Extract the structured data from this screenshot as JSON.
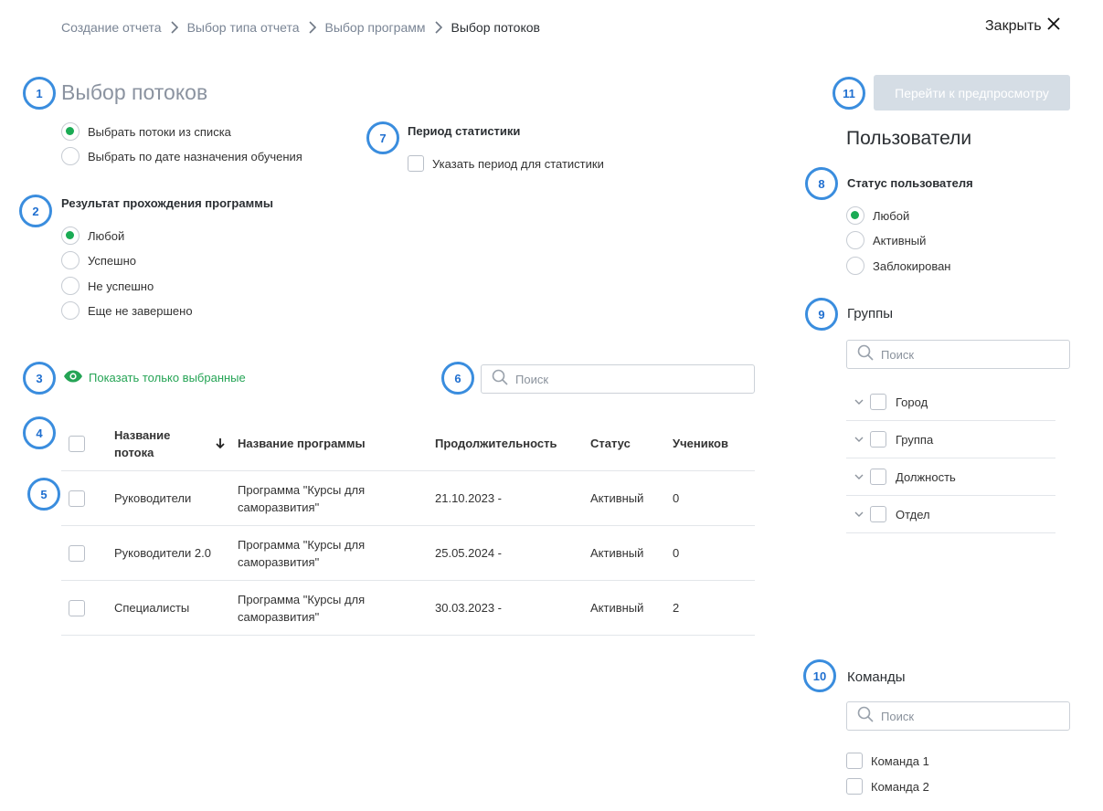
{
  "breadcrumb": {
    "items": [
      "Создание отчета",
      "Выбор типа отчета",
      "Выбор программ"
    ],
    "current": "Выбор потоков"
  },
  "close_label": "Закрыть",
  "markers": [
    "1",
    "2",
    "3",
    "4",
    "5",
    "6",
    "7",
    "8",
    "9",
    "10",
    "11"
  ],
  "title": "Выбор потоков",
  "stream_selection": {
    "options": [
      {
        "label": "Выбрать потоки из списка",
        "selected": true
      },
      {
        "label": "Выбрать по дате назначения обучения",
        "selected": false
      }
    ]
  },
  "program_result": {
    "label": "Результат прохождения программы",
    "options": [
      {
        "label": "Любой",
        "selected": true
      },
      {
        "label": "Успешно",
        "selected": false
      },
      {
        "label": "Не успешно",
        "selected": false
      },
      {
        "label": "Еще не завершено",
        "selected": false
      }
    ]
  },
  "stats_period": {
    "label": "Период статистики",
    "checkbox_label": "Указать период для статистики",
    "checked": false
  },
  "show_selected_label": "Показать только выбранные",
  "table_search": {
    "placeholder": "Поиск",
    "value": ""
  },
  "table": {
    "headers": [
      "Название потока",
      "Название программы",
      "Продолжительность",
      "Статус",
      "Учеников"
    ],
    "rows": [
      {
        "name": "Руководители",
        "program": "Программа \"Курсы для саморазвития\"",
        "duration": "21.10.2023 -",
        "status": "Активный",
        "students": "0"
      },
      {
        "name": "Руководители 2.0",
        "program": "Программа \"Курсы для саморазвития\"",
        "duration": "25.05.2024 -",
        "status": "Активный",
        "students": "0"
      },
      {
        "name": "Специалисты",
        "program": "Программа \"Курсы для саморазвития\"",
        "duration": "30.03.2023 -",
        "status": "Активный",
        "students": "2"
      }
    ]
  },
  "preview_button": {
    "label": "Перейти к предпросмотру",
    "enabled": false
  },
  "users": {
    "title": "Пользователи",
    "status_label": "Статус пользователя",
    "status_options": [
      {
        "label": "Любой",
        "selected": true
      },
      {
        "label": "Активный",
        "selected": false
      },
      {
        "label": "Заблокирован",
        "selected": false
      }
    ],
    "groups_label": "Группы",
    "groups_search_placeholder": "Поиск",
    "groups": [
      "Город",
      "Группа",
      "Должность",
      "Отдел"
    ],
    "teams_label": "Команды",
    "teams_search_placeholder": "Поиск",
    "teams": [
      "Команда 1",
      "Команда 2"
    ]
  },
  "colors": {
    "accent_green": "#1aab54",
    "marker_blue": "#3a8dde",
    "disabled_button": "#d5dde5"
  }
}
